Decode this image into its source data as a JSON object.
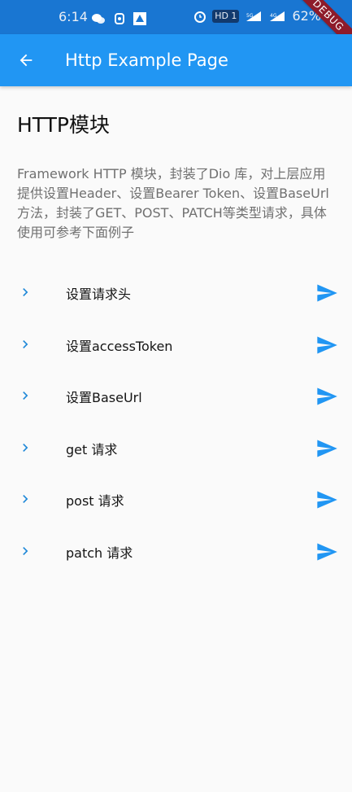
{
  "status_bar": {
    "time": "6:14",
    "network_badge": "HD 1",
    "network_5g": "5G",
    "network_4g": "4G",
    "battery": "62%",
    "debug_label": "DEBUG"
  },
  "app_bar": {
    "title": "Http Example Page"
  },
  "section": {
    "title": "HTTP模块",
    "description": "Framework HTTP 模块，封装了Dio 库，对上层应用提供设置Header、设置Bearer Token、设置BaseUrl方法，封装了GET、POST、PATCH等类型请求，具体使用可参考下面例子"
  },
  "items": [
    {
      "label": "设置请求头"
    },
    {
      "label": "设置accessToken"
    },
    {
      "label": "设置BaseUrl"
    },
    {
      "label": "get 请求"
    },
    {
      "label": "post 请求"
    },
    {
      "label": "patch 请求"
    }
  ],
  "colors": {
    "status_bar": "#1976d2",
    "app_bar": "#2196f3",
    "accent": "#2196f3",
    "background": "#fafafa"
  }
}
